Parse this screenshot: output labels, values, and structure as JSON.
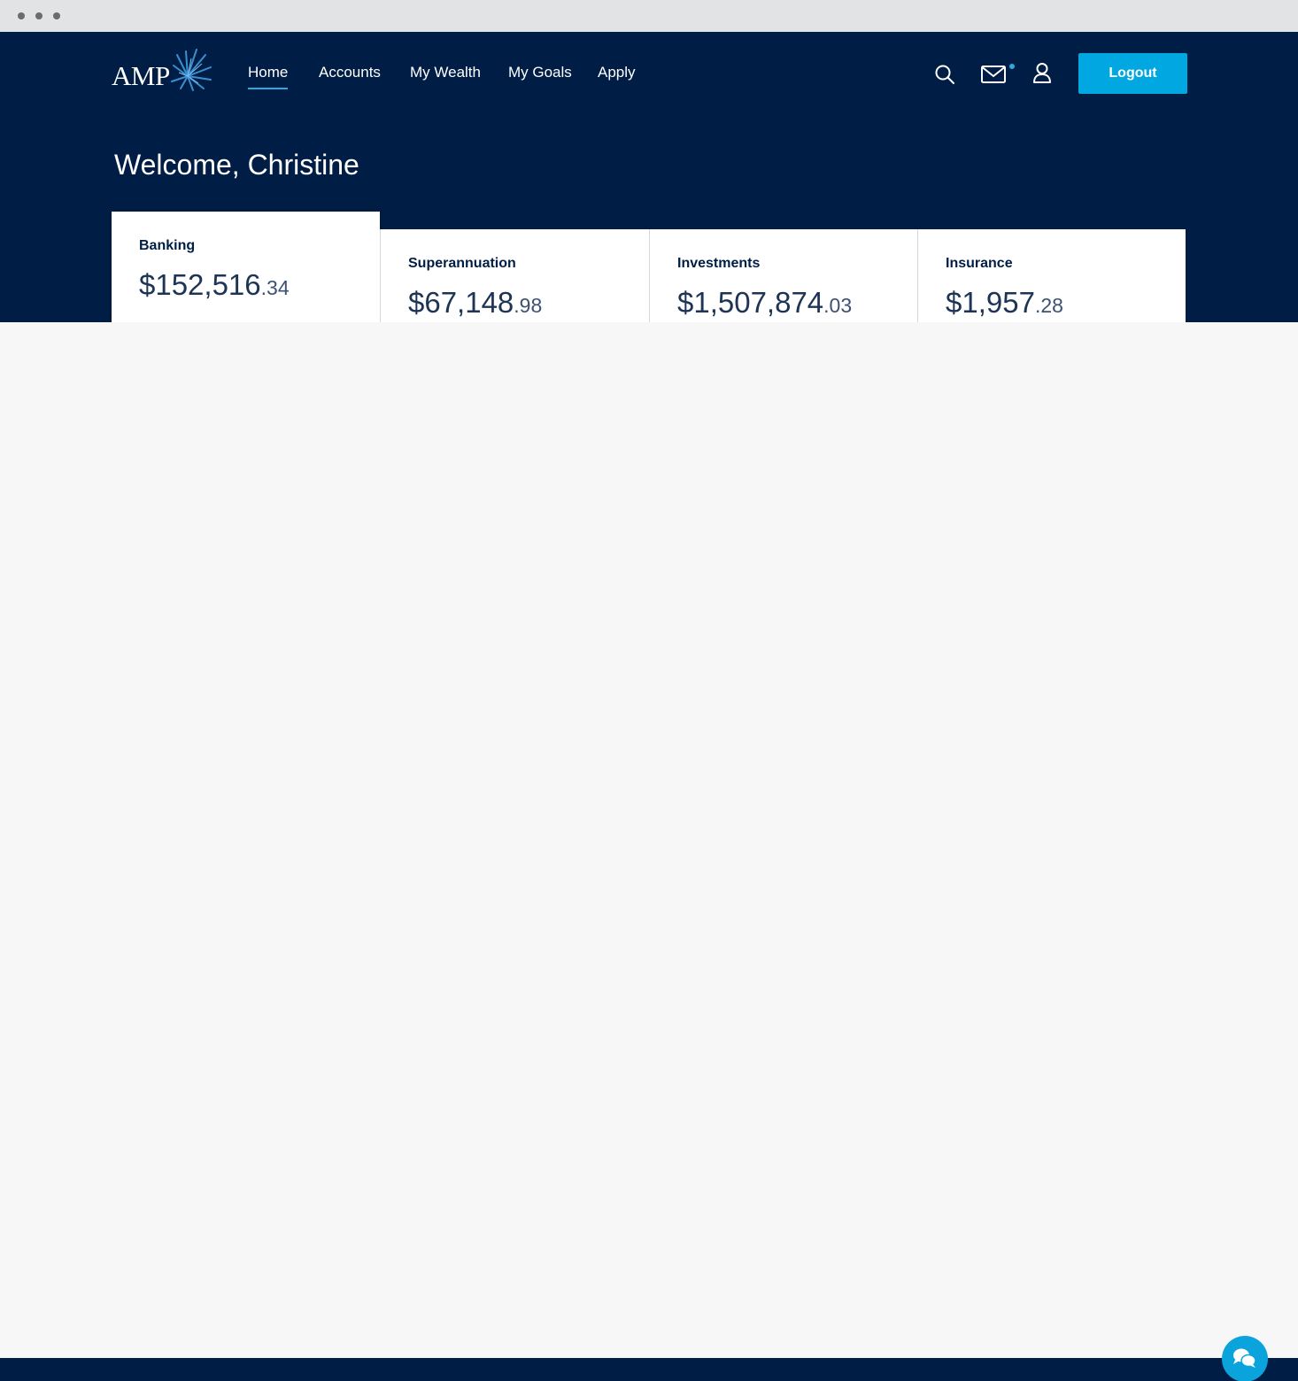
{
  "brand": {
    "logo_text": "AMP",
    "accent": "#00a7e1",
    "navy": "#001e45"
  },
  "nav": {
    "items": [
      {
        "label": "Home",
        "active": true
      },
      {
        "label": "Accounts",
        "active": false
      },
      {
        "label": "My Wealth",
        "active": false
      },
      {
        "label": "My Goals",
        "active": false
      },
      {
        "label": "Apply",
        "active": false
      }
    ]
  },
  "header_icons": [
    "search-icon",
    "mail-icon",
    "user-icon"
  ],
  "logout_label": "Logout",
  "welcome": "Welcome, Christine",
  "cards": [
    {
      "label": "Banking",
      "amount_whole": "$152,516",
      "amount_cents": ".34",
      "selected": true
    },
    {
      "label": "Superannuation",
      "amount_whole": "$67,148",
      "amount_cents": ".98",
      "selected": false
    },
    {
      "label": "Investments",
      "amount_whole": "$1,507,874",
      "amount_cents": ".03",
      "selected": false
    },
    {
      "label": "Insurance",
      "amount_whole": "$1,957",
      "amount_cents": ".28",
      "selected": false
    }
  ],
  "chat_icon": "chat-icon"
}
